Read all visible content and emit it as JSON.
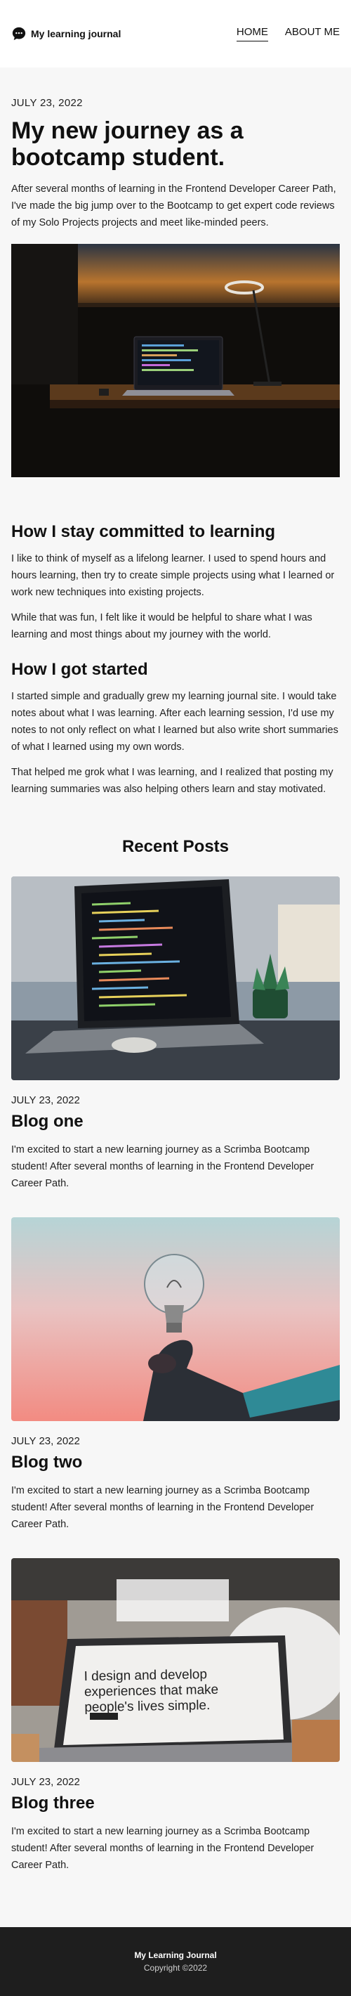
{
  "header": {
    "brand": "My learning journal",
    "logo_icon": "chat-bubble-icon",
    "nav": [
      {
        "label": "HOME",
        "active": true
      },
      {
        "label": "ABOUT ME",
        "active": false
      }
    ]
  },
  "hero": {
    "date": "JULY 23, 2022",
    "title": "My new journey as a bootcamp student.",
    "description": "After several months of learning in the Frontend Developer Career Path, I've made the big jump over to the Bootcamp to get expert code reviews of my Solo Projects projects and meet like-minded peers."
  },
  "sections": [
    {
      "title": "How I stay committed to learning",
      "paragraphs": [
        "I like to think of myself as a lifelong learner. I used to spend hours and hours learning, then try to create simple projects using what I learned or work new techniques into existing projects.",
        "While that was fun, I felt like it would be helpful to share what I was learning and most things about my journey with the world."
      ]
    },
    {
      "title": "How I got started",
      "paragraphs": [
        "I started simple and gradually grew my learning journal site. I would take notes about what I was learning. After each learning session, I'd use my notes to not only reflect on what I learned but also write short summaries of what I learned using my own words.",
        "That helped me grok what I was learning, and I realized that posting my learning summaries was also helping others learn and stay motivated."
      ]
    }
  ],
  "recent": {
    "title": "Recent Posts",
    "posts": [
      {
        "date": "JULY 23, 2022",
        "title": "Blog one",
        "description": "I'm excited to start a new learning journey as a Scrimba Bootcamp student! After several months of learning in the Frontend Developer Career Path."
      },
      {
        "date": "JULY 23, 2022",
        "title": "Blog two",
        "description": "I'm excited to start a new learning journey as a Scrimba Bootcamp student! After several months of learning in the Frontend Developer Career Path."
      },
      {
        "date": "JULY 23, 2022",
        "title": "Blog three",
        "description": "I'm excited to start a new learning journey as a Scrimba Bootcamp student! After several months of learning in the Frontend Developer Career Path.",
        "image_text": "I design and develop experiences that make people's lives simple."
      }
    ]
  },
  "footer": {
    "title": "My Learning Journal",
    "copyright": "Copyright ©2022"
  }
}
